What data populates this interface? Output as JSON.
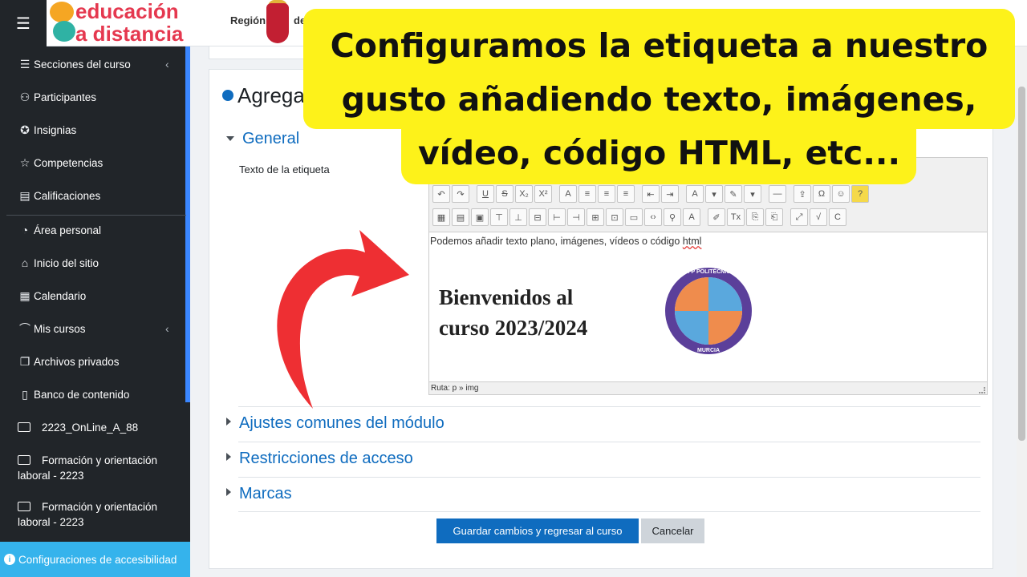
{
  "header": {
    "menu_icon": "hamburger-icon",
    "logo_line1": "educación",
    "logo_line2": "a distancia",
    "region_label": "Región",
    "de_label": "de"
  },
  "sidebar": {
    "items": [
      {
        "label": "Secciones del curso",
        "icon": "list-icon",
        "chevron": "‹"
      },
      {
        "label": "Participantes",
        "icon": "users-icon"
      },
      {
        "label": "Insignias",
        "icon": "badge-icon"
      },
      {
        "label": "Competencias",
        "icon": "star-icon"
      },
      {
        "label": "Calificaciones",
        "icon": "gradebook-icon"
      },
      {
        "label": "Área personal",
        "icon": "dashboard-icon"
      },
      {
        "label": "Inicio del sitio",
        "icon": "home-icon"
      },
      {
        "label": "Calendario",
        "icon": "calendar-icon"
      },
      {
        "label": "Mis cursos",
        "icon": "graduation-cap-icon",
        "chevron": "‹"
      },
      {
        "label": "Archivos privados",
        "icon": "files-icon"
      },
      {
        "label": "Banco de contenido",
        "icon": "clipboard-icon"
      }
    ],
    "folders": [
      {
        "label": "2223_OnLine_A_88"
      },
      {
        "label": "Formación y orientación laboral - 2223"
      },
      {
        "label": "Formación y orientación laboral - 2223"
      }
    ],
    "accessibility": "Configuraciones de accesibilidad"
  },
  "main": {
    "title": "Agregar",
    "sections": {
      "general": "General",
      "common": "Ajustes comunes del módulo",
      "restrictions": "Restricciones de acceso",
      "tags": "Marcas"
    },
    "field_label": "Texto de la etiqueta",
    "editor": {
      "line_text": "Podemos añadir texto plano, imágenes, vídeos o código ",
      "line_link": "html",
      "welcome_line1": "Bienvenidos al",
      "welcome_line2": "curso 2023/2024",
      "emblem_top": "CIFP POLITÉCNICO",
      "emblem_bottom": "MURCIA",
      "status": "Ruta: p » img"
    },
    "save_button": "Guardar cambios y regresar al curso",
    "cancel_button": "Cancelar"
  },
  "callout": {
    "text": "Configuramos la etiqueta a nuestro gusto añadiendo texto, imágenes, vídeo, código HTML, etc..."
  },
  "colors": {
    "sidebar_bg": "#212529",
    "accent": "#0f6cbf",
    "callout_bg": "#fdf21a",
    "arrow": "#ee2f33",
    "accessibility_bg": "#35b3ec"
  }
}
